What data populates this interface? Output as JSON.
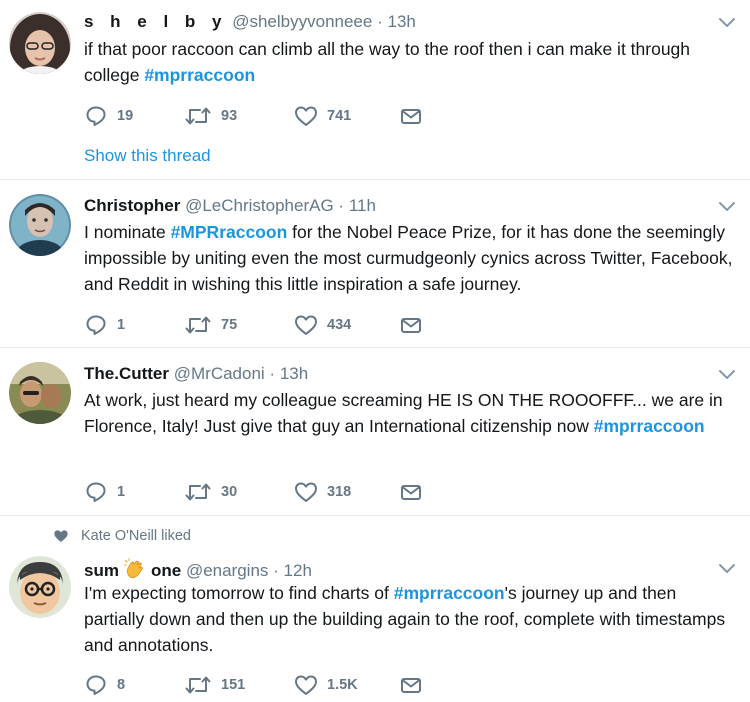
{
  "colors": {
    "accent": "#1b95e0",
    "muted": "#657786",
    "text": "#14171a",
    "divider": "#e6ecf0"
  },
  "icons": {
    "reply": "reply-icon",
    "retweet": "retweet-icon",
    "like": "heart-icon",
    "direct_message": "envelope-icon",
    "caret": "chevron-down-icon",
    "liked_context": "heart-icon",
    "name_emoji": "clapping-hands-icon"
  },
  "tweets": [
    {
      "name": "s h e l b y",
      "handle": "@shelbyyvonneee",
      "separator": "·",
      "time": "13h",
      "text_before": "if that poor raccoon can climb all the way to the roof then i can make it through college ",
      "hashtag": "#mprraccoon",
      "replies": "19",
      "retweets": "93",
      "likes": "741",
      "thread_link": "Show this thread"
    },
    {
      "name": "Christopher",
      "handle": "@LeChristopherAG",
      "separator": "·",
      "time": "11h",
      "text_before": "I nominate ",
      "hashtag": "#MPRraccoon",
      "text_after": " for the Nobel Peace Prize, for it has done the seemingly impossible by uniting even the most curmudgeonly cynics across Twitter, Facebook, and Reddit in wishing this little inspiration a safe journey.",
      "replies": "1",
      "retweets": "75",
      "likes": "434"
    },
    {
      "name": "The.Cutter",
      "handle": "@MrCadoni",
      "separator": "·",
      "time": "13h",
      "text_before": "At work, just heard my colleague screaming HE IS ON THE ROOOFFF... we are in Florence, Italy! Just give that guy an International citizenship now ",
      "hashtag": "#mprraccoon",
      "replies": "1",
      "retweets": "30",
      "likes": "318"
    },
    {
      "liked_by": "Kate O'Neill liked",
      "name_part1": "sum",
      "name_part2": "one",
      "handle": "@enargins",
      "separator": "·",
      "time": "12h",
      "text_before": "I'm expecting tomorrow to find charts of ",
      "hashtag": "#mprraccoon",
      "text_after": "'s journey up and then partially down and then up the building again to the roof, complete with timestamps and annotations.",
      "replies": "8",
      "retweets": "151",
      "likes": "1.5K"
    }
  ]
}
